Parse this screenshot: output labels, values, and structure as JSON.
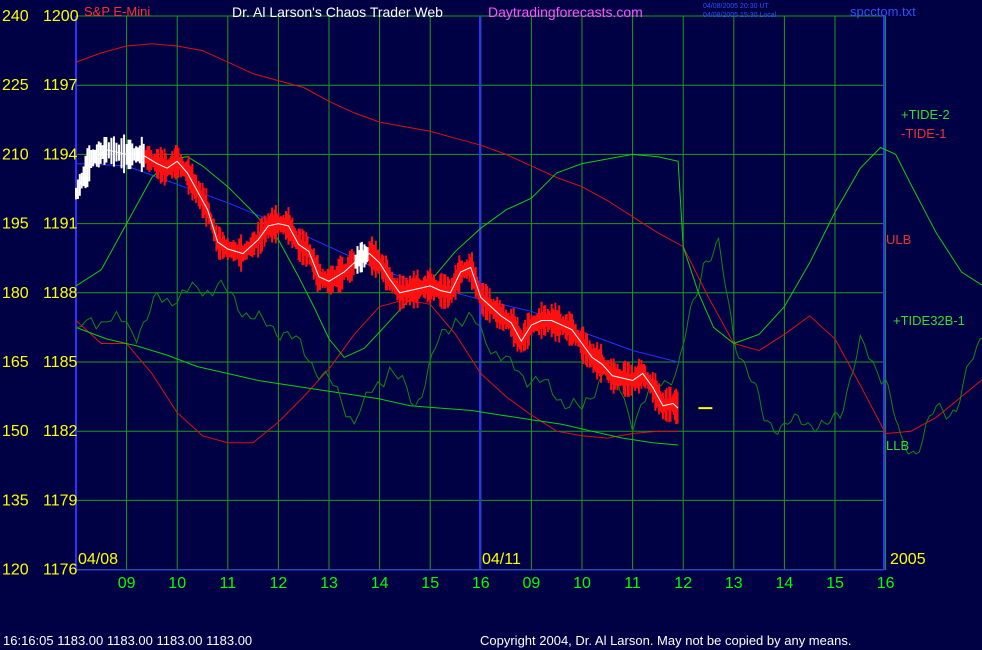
{
  "header": {
    "symbol": "S&P E-Mini",
    "title": "Dr. Al Larson's Chaos Trader Web",
    "site": "Daytradingforecasts.com",
    "time_ut": "04/08/2005 20:30 UT",
    "time_local": "04/08/2005 15:30 Local",
    "file": "spcctom.txt"
  },
  "footer": {
    "quote": "16:16:05  1183.00 1183.00 1183.00 1183.00",
    "copyright": "Copyright 2004, Dr. Al Larson. May not be copied by any means."
  },
  "dates": {
    "start": "04/08",
    "mid": "04/11",
    "year": "2005"
  },
  "colors": {
    "background": "#000044",
    "grid": "#1f9a1f",
    "axis": "#3030ff",
    "axis_labels": "#ffff00",
    "hour_labels": "#00ff00",
    "price_bars": "#ff1010",
    "smooth_price": "#ffffff",
    "tide2": "#11cc11",
    "tide1": "#dd1111",
    "tide32b": "#118811",
    "blue_line": "#2233ff"
  },
  "chart_data": {
    "type": "line",
    "title": "S&P E-Mini",
    "xlabel": "",
    "ylabel": "",
    "grid": true,
    "y_left_labels": [
      "240",
      "225",
      "210",
      "195",
      "180",
      "165",
      "150",
      "135",
      "120"
    ],
    "y_right_labels": [
      "1200",
      "1197",
      "1194",
      "1191",
      "1188",
      "1185",
      "1182",
      "1179",
      "1176"
    ],
    "ylim": [
      1176,
      1200
    ],
    "x_ticks": [
      "09",
      "10",
      "11",
      "12",
      "13",
      "14",
      "15",
      "16",
      "09",
      "10",
      "11",
      "12",
      "13",
      "14",
      "15",
      "16"
    ],
    "series": [
      {
        "name": "S&P E-Mini",
        "points": [
          [
            0,
            1192.3
          ],
          [
            0.3,
            1193.8
          ],
          [
            0.6,
            1194.2
          ],
          [
            1.0,
            1194.0
          ],
          [
            1.3,
            1194.0
          ],
          [
            1.6,
            1193.6
          ],
          [
            1.8,
            1193.4
          ],
          [
            2.0,
            1193.7
          ],
          [
            2.2,
            1193.2
          ],
          [
            2.4,
            1192.4
          ],
          [
            2.6,
            1191.6
          ],
          [
            2.8,
            1190.2
          ],
          [
            3.0,
            1189.9
          ],
          [
            3.3,
            1189.7
          ],
          [
            3.6,
            1190.3
          ],
          [
            3.8,
            1190.9
          ],
          [
            4.0,
            1191.0
          ],
          [
            4.2,
            1190.9
          ],
          [
            4.4,
            1190.1
          ],
          [
            4.6,
            1189.8
          ],
          [
            4.8,
            1188.7
          ],
          [
            5.0,
            1188.5
          ],
          [
            5.3,
            1188.9
          ],
          [
            5.6,
            1189.5
          ],
          [
            5.8,
            1189.7
          ],
          [
            6.0,
            1189.3
          ],
          [
            6.2,
            1188.6
          ],
          [
            6.4,
            1188.0
          ],
          [
            6.6,
            1188.1
          ],
          [
            6.8,
            1188.2
          ],
          [
            7.0,
            1188.3
          ],
          [
            7.2,
            1188.1
          ],
          [
            7.4,
            1188.0
          ],
          [
            7.6,
            1188.9
          ],
          [
            7.8,
            1189.1
          ],
          [
            8.0,
            1187.8
          ],
          [
            8.2,
            1187.4
          ],
          [
            8.4,
            1187.0
          ],
          [
            8.6,
            1186.7
          ],
          [
            8.8,
            1185.9
          ],
          [
            9.0,
            1186.6
          ],
          [
            9.2,
            1186.8
          ],
          [
            9.4,
            1186.8
          ],
          [
            9.6,
            1186.6
          ],
          [
            9.8,
            1186.4
          ],
          [
            10.0,
            1185.8
          ],
          [
            10.2,
            1185.2
          ],
          [
            10.4,
            1184.9
          ],
          [
            10.6,
            1184.4
          ],
          [
            10.8,
            1184.3
          ],
          [
            11.0,
            1184.2
          ],
          [
            11.2,
            1184.5
          ],
          [
            11.4,
            1183.9
          ],
          [
            11.6,
            1183.1
          ],
          [
            11.8,
            1183.2
          ],
          [
            11.9,
            1183.0
          ]
        ]
      },
      {
        "name": "+TIDE-2",
        "points": [
          [
            0,
            1188.3
          ],
          [
            0.5,
            1189.0
          ],
          [
            1.0,
            1191.0
          ],
          [
            1.5,
            1193.0
          ],
          [
            1.9,
            1193.8
          ],
          [
            2.2,
            1193.9
          ],
          [
            2.5,
            1193.5
          ],
          [
            3.0,
            1192.6
          ],
          [
            3.5,
            1191.5
          ],
          [
            4.0,
            1190.3
          ],
          [
            4.4,
            1188.7
          ],
          [
            4.7,
            1187.4
          ],
          [
            5.0,
            1186.0
          ],
          [
            5.3,
            1185.2
          ],
          [
            5.7,
            1185.6
          ],
          [
            6.0,
            1186.3
          ],
          [
            6.5,
            1187.5
          ],
          [
            7.0,
            1188.5
          ],
          [
            7.5,
            1189.8
          ],
          [
            8.0,
            1190.8
          ],
          [
            8.5,
            1191.6
          ],
          [
            9.0,
            1192.1
          ],
          [
            9.5,
            1193.2
          ],
          [
            10.0,
            1193.6
          ],
          [
            10.5,
            1193.8
          ],
          [
            11.0,
            1194.0
          ],
          [
            11.5,
            1193.9
          ],
          [
            11.9,
            1193.7
          ],
          [
            12.0,
            1190.0
          ],
          [
            12.3,
            1188.0
          ],
          [
            12.6,
            1186.5
          ],
          [
            13.0,
            1185.8
          ],
          [
            13.5,
            1186.2
          ],
          [
            14.0,
            1187.4
          ],
          [
            14.5,
            1189.3
          ],
          [
            15.0,
            1191.5
          ],
          [
            15.5,
            1193.4
          ],
          [
            15.9,
            1194.3
          ],
          [
            16.2,
            1194.0
          ],
          [
            16.5,
            1192.7
          ],
          [
            17.0,
            1190.6
          ],
          [
            17.5,
            1188.9
          ],
          [
            18.0,
            1188.2
          ],
          [
            18.5,
            1188.4
          ],
          [
            19.0,
            1188.7
          ],
          [
            19.5,
            1188.5
          ],
          [
            20.0,
            1188.4
          ],
          [
            20.5,
            1189.3
          ],
          [
            21.0,
            1190.6
          ],
          [
            21.5,
            1192.0
          ],
          [
            21.9,
            1192.7
          ],
          [
            22.3,
            1192.0
          ],
          [
            22.6,
            1190.5
          ],
          [
            23.0,
            1187.8
          ],
          [
            23.3,
            1185.1
          ],
          [
            23.6,
            1182.9
          ]
        ]
      },
      {
        "name": "-TIDE-1",
        "points": [
          [
            0,
            1198.0
          ],
          [
            0.5,
            1198.4
          ],
          [
            1.0,
            1198.7
          ],
          [
            1.5,
            1198.8
          ],
          [
            2.0,
            1198.7
          ],
          [
            2.5,
            1198.5
          ],
          [
            3.0,
            1198.0
          ],
          [
            3.5,
            1197.5
          ],
          [
            4.0,
            1197.2
          ],
          [
            4.5,
            1196.9
          ],
          [
            5.0,
            1196.3
          ],
          [
            5.5,
            1195.8
          ],
          [
            6.0,
            1195.4
          ],
          [
            6.5,
            1195.2
          ],
          [
            7.0,
            1195.0
          ],
          [
            7.5,
            1194.7
          ],
          [
            8.0,
            1194.4
          ],
          [
            8.5,
            1194.0
          ],
          [
            9.0,
            1193.5
          ],
          [
            9.5,
            1193.0
          ],
          [
            10.0,
            1192.6
          ],
          [
            10.5,
            1192.0
          ],
          [
            11.0,
            1191.3
          ],
          [
            11.5,
            1190.6
          ],
          [
            12.0,
            1190.0
          ],
          [
            12.5,
            1187.8
          ],
          [
            13.0,
            1185.8
          ],
          [
            13.5,
            1185.5
          ],
          [
            14.0,
            1186.2
          ],
          [
            14.5,
            1187.0
          ],
          [
            15.0,
            1186.0
          ],
          [
            15.5,
            1184.0
          ],
          [
            16.0,
            1181.9
          ],
          [
            16.5,
            1182.0
          ],
          [
            17.0,
            1182.6
          ],
          [
            17.5,
            1183.5
          ],
          [
            18.0,
            1184.4
          ],
          [
            18.5,
            1185.5
          ],
          [
            19.0,
            1186.3
          ],
          [
            19.5,
            1186.9
          ],
          [
            20.0,
            1187.2
          ],
          [
            20.5,
            1186.6
          ],
          [
            21.0,
            1185.4
          ],
          [
            21.5,
            1183.9
          ],
          [
            22.0,
            1183.0
          ],
          [
            22.4,
            1182.8
          ],
          [
            22.8,
            1184.0
          ],
          [
            23.2,
            1186.6
          ],
          [
            23.6,
            1189.1
          ],
          [
            23.9,
            1190.5
          ]
        ]
      },
      {
        "name": "ULB",
        "points": [
          [
            0,
            1186.8
          ],
          [
            0.5,
            1185.8
          ],
          [
            1.0,
            1185.8
          ],
          [
            1.5,
            1184.5
          ],
          [
            2.0,
            1182.8
          ],
          [
            2.5,
            1181.8
          ],
          [
            3.0,
            1181.5
          ],
          [
            3.5,
            1181.5
          ],
          [
            4.0,
            1182.4
          ],
          [
            4.5,
            1183.5
          ],
          [
            5.0,
            1184.7
          ],
          [
            5.5,
            1186.2
          ],
          [
            6.0,
            1187.4
          ],
          [
            6.5,
            1187.7
          ],
          [
            7.0,
            1187.5
          ],
          [
            7.5,
            1186.2
          ],
          [
            8.0,
            1184.5
          ],
          [
            8.5,
            1183.5
          ],
          [
            9.0,
            1182.7
          ],
          [
            9.5,
            1182.0
          ],
          [
            10.0,
            1181.8
          ],
          [
            10.5,
            1181.7
          ],
          [
            11.0,
            1181.9
          ],
          [
            11.5,
            1182.0
          ],
          [
            11.9,
            1182.0
          ]
        ]
      },
      {
        "name": "+TIDE32B-1",
        "points": [
          [
            0,
            1186.3
          ],
          [
            0.6,
            1187.0
          ],
          [
            1.2,
            1186.3
          ],
          [
            1.6,
            1187.6
          ],
          [
            2.2,
            1188.0
          ],
          [
            2.8,
            1188.3
          ],
          [
            3.2,
            1187.5
          ],
          [
            3.7,
            1186.6
          ],
          [
            4.1,
            1186.4
          ],
          [
            4.6,
            1185.2
          ],
          [
            5.0,
            1184.1
          ],
          [
            5.5,
            1182.5
          ],
          [
            6.2,
            1184.8
          ],
          [
            6.7,
            1183.1
          ],
          [
            7.1,
            1185.5
          ],
          [
            7.5,
            1187.0
          ],
          [
            7.9,
            1186.6
          ],
          [
            8.5,
            1184.9
          ],
          [
            9.0,
            1184.3
          ],
          [
            9.5,
            1183.6
          ],
          [
            10.0,
            1182.8
          ],
          [
            10.5,
            1185.0
          ],
          [
            11.0,
            1182.5
          ],
          [
            11.5,
            1184.1
          ],
          [
            11.9,
            1184.6
          ],
          [
            12.1,
            1186.6
          ],
          [
            12.4,
            1189.4
          ],
          [
            12.7,
            1189.9
          ],
          [
            13.0,
            1186.2
          ],
          [
            13.3,
            1184.4
          ],
          [
            13.6,
            1182.6
          ],
          [
            14.0,
            1182.1
          ],
          [
            14.4,
            1182.6
          ],
          [
            14.8,
            1182.0
          ],
          [
            15.1,
            1182.9
          ],
          [
            15.5,
            1185.7
          ],
          [
            16.0,
            1184.3
          ],
          [
            16.3,
            1181.4
          ],
          [
            16.6,
            1181.2
          ],
          [
            17.0,
            1182.9
          ],
          [
            17.4,
            1183.0
          ],
          [
            17.8,
            1185.6
          ],
          [
            18.2,
            1187.9
          ],
          [
            18.6,
            1185.5
          ],
          [
            19.0,
            1184.3
          ],
          [
            19.4,
            1183.9
          ],
          [
            19.8,
            1182.9
          ],
          [
            20.3,
            1184.6
          ],
          [
            20.7,
            1186.5
          ],
          [
            21.1,
            1185.4
          ],
          [
            21.5,
            1184.6
          ],
          [
            21.9,
            1182.8
          ],
          [
            22.3,
            1183.4
          ],
          [
            22.7,
            1185.6
          ],
          [
            23.1,
            1187.9
          ],
          [
            23.5,
            1187.0
          ],
          [
            23.9,
            1186.2
          ]
        ]
      },
      {
        "name": "LLB",
        "points": [
          [
            0,
            1186.5
          ],
          [
            0.6,
            1186.0
          ],
          [
            1.2,
            1185.7
          ],
          [
            1.8,
            1185.3
          ],
          [
            2.4,
            1184.8
          ],
          [
            3.0,
            1184.5
          ],
          [
            3.6,
            1184.2
          ],
          [
            4.2,
            1184.0
          ],
          [
            4.8,
            1183.8
          ],
          [
            5.4,
            1183.6
          ],
          [
            6.0,
            1183.4
          ],
          [
            6.6,
            1183.1
          ],
          [
            7.2,
            1183.0
          ],
          [
            7.8,
            1182.9
          ],
          [
            8.4,
            1182.7
          ],
          [
            9.0,
            1182.5
          ],
          [
            9.6,
            1182.3
          ],
          [
            10.2,
            1182.0
          ],
          [
            10.8,
            1181.7
          ],
          [
            11.4,
            1181.5
          ],
          [
            11.9,
            1181.4
          ]
        ]
      },
      {
        "name": "blue",
        "points": [
          [
            0,
            1193.6
          ],
          [
            1.0,
            1193.5
          ],
          [
            2.0,
            1192.7
          ],
          [
            3.0,
            1191.9
          ],
          [
            4.0,
            1191.0
          ],
          [
            5.0,
            1190.0
          ],
          [
            6.0,
            1189.0
          ],
          [
            7.0,
            1188.3
          ],
          [
            8.0,
            1187.7
          ],
          [
            9.0,
            1187.2
          ],
          [
            10.0,
            1186.3
          ],
          [
            11.0,
            1185.5
          ],
          [
            11.9,
            1185.0
          ]
        ]
      }
    ],
    "forecast_marker": {
      "x": 12.3,
      "y": 1183.0
    },
    "legend": [
      {
        "name": "+TIDE-2",
        "position": "right"
      },
      {
        "name": "-TIDE-1",
        "position": "right"
      },
      {
        "name": "ULB",
        "position": "right"
      },
      {
        "name": "+TIDE32B-1",
        "position": "right"
      },
      {
        "name": "LLB",
        "position": "right"
      }
    ]
  }
}
